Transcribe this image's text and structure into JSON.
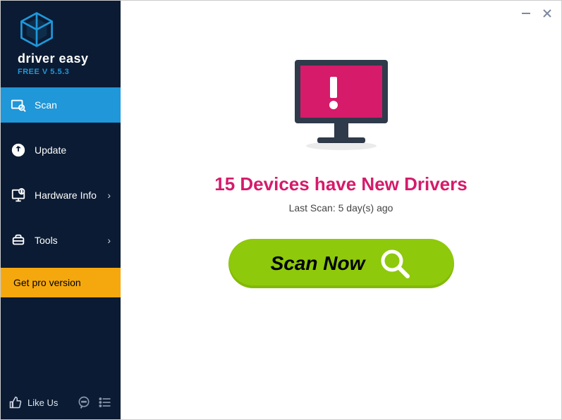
{
  "app": {
    "name": "driver easy",
    "version_label": "FREE V 5.5.3"
  },
  "sidebar": {
    "items": [
      {
        "label": "Scan",
        "has_chevron": false,
        "active": true
      },
      {
        "label": "Update",
        "has_chevron": false,
        "active": false
      },
      {
        "label": "Hardware Info",
        "has_chevron": true,
        "active": false
      },
      {
        "label": "Tools",
        "has_chevron": true,
        "active": false
      }
    ],
    "pro_label": "Get pro version",
    "like_us_label": "Like Us"
  },
  "main": {
    "headline": "15 Devices have New Drivers",
    "last_scan": "Last Scan: 5 day(s) ago",
    "scan_button_label": "Scan Now"
  },
  "colors": {
    "sidebar_bg": "#0b1b33",
    "accent_blue": "#1f97d9",
    "pro_orange": "#f5a80e",
    "headline_pink": "#d51b6a",
    "scan_green": "#8ec90b",
    "monitor_screen": "#d51b6a"
  }
}
